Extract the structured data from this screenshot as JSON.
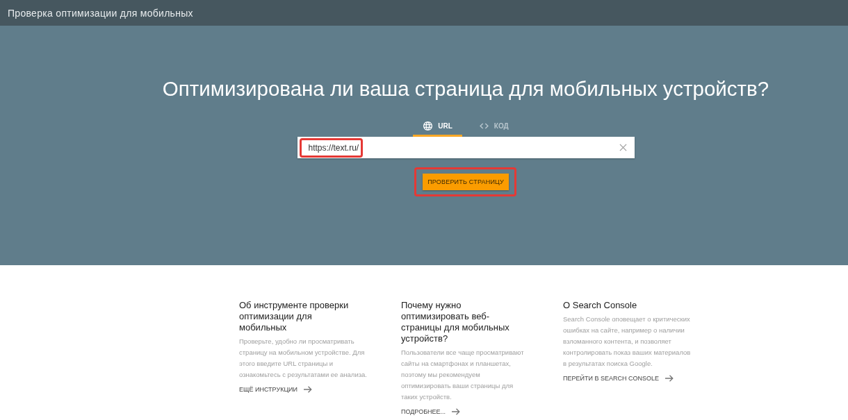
{
  "header": {
    "title": "Проверка оптимизации для мобильных"
  },
  "hero": {
    "heading": "Оптимизирована ли ваша страница для мобильных устройств?",
    "tabs": [
      {
        "label": "URL",
        "selected": true
      },
      {
        "label": "КОД",
        "selected": false
      }
    ],
    "url_field": {
      "value": "https://text.ru/",
      "highlighted": true
    },
    "check_button": {
      "label": "ПРОВЕРИТЬ СТРАНИЦУ",
      "highlighted": true
    }
  },
  "info_columns": [
    {
      "title": "Об инструменте проверки оптимизации для мобильных",
      "text": "Проверьте, удобно ли просматривать страницу на мобильном устройстве. Для этого введите URL страницы и ознакомьтесь с результатами ее анализа.",
      "link": "ЕЩЁ ИНСТРУКЦИИ"
    },
    {
      "title": "Почему нужно оптимизировать веб-страницы для мобильных устройств?",
      "text": "Пользователи все чаще просматривают сайты на смартфонах и планшетах, поэтому мы рекомендуем оптимизировать ваши страницы для таких устройств.",
      "link": "ПОДРОБНЕЕ..."
    },
    {
      "title": "О Search Console",
      "text": "Search Console оповещает о критических ошибках на сайте, например о наличии взломанного контента, и позволяет контролировать показ ваших материалов в результатах поиска Google.",
      "link": "ПЕРЕЙТИ В SEARCH CONSOLE"
    }
  ]
}
